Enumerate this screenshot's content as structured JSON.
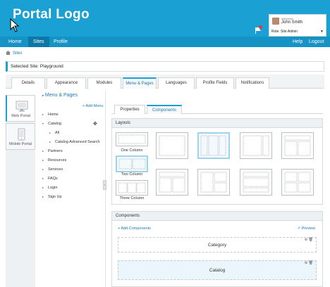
{
  "header": {
    "logo_text": "Portal Logo",
    "user": {
      "welcome": "Welcome",
      "name": "John Smith",
      "role": "Role: Site Admin"
    }
  },
  "nav": {
    "items": [
      {
        "label": "Home"
      },
      {
        "label": "Sites"
      },
      {
        "label": "Profile"
      }
    ],
    "right": [
      {
        "label": "Help"
      },
      {
        "label": "Logout"
      }
    ],
    "active": "Sites"
  },
  "breadcrumb": {
    "label": "Sites"
  },
  "selected_site": {
    "label": "Selected Site: Playground"
  },
  "main_tabs": [
    {
      "label": "Details"
    },
    {
      "label": "Appearance"
    },
    {
      "label": "Modules"
    },
    {
      "label": "Menu & Pages"
    },
    {
      "label": "Languages"
    },
    {
      "label": "Profile Fields"
    },
    {
      "label": "Notifications"
    }
  ],
  "portals": [
    {
      "label": "Web Portal"
    },
    {
      "label": "Mobile Portal"
    }
  ],
  "menu": {
    "title": "Menu & Pages",
    "add_label": "Add Menu",
    "items": [
      {
        "label": "Home"
      },
      {
        "label": "Catalog"
      },
      {
        "label": "All"
      },
      {
        "label": "Catalog Advanced Search"
      },
      {
        "label": "Partners"
      },
      {
        "label": "Resources"
      },
      {
        "label": "Services"
      },
      {
        "label": "FAQs"
      },
      {
        "label": "Login"
      },
      {
        "label": "Sign Up"
      }
    ]
  },
  "sub_tabs": [
    {
      "label": "Properties"
    },
    {
      "label": "Components"
    }
  ],
  "layouts": {
    "title": "Layouts",
    "labels": [
      "One Column",
      "Two Column",
      "Three Column"
    ]
  },
  "components": {
    "title": "Components",
    "add_label": "Add Components",
    "preview_label": "Preview",
    "blocks": [
      {
        "label": "Category"
      },
      {
        "label": "Catalog"
      }
    ]
  },
  "colors": {
    "header_bg": "#1aa0d2",
    "nav_bg": "#1593c4",
    "accent": "#1a7bb3"
  }
}
